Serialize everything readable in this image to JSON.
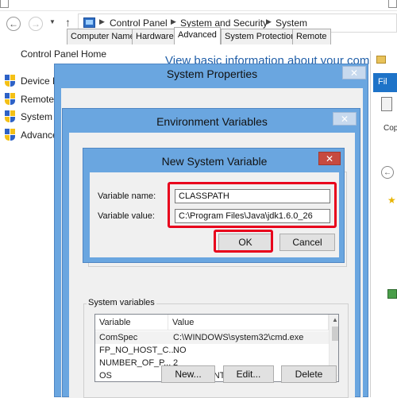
{
  "explorer": {
    "breadcrumbs": [
      "Control Panel",
      "System and Security",
      "System"
    ],
    "left_pane": {
      "home_link": "Control Panel Home",
      "links": [
        "Device M",
        "Remote",
        "System p",
        "Advance"
      ]
    },
    "heading": "View basic information about your com",
    "right_pane": {
      "ribbon_tab": "Fil",
      "copy_label": "Cop"
    }
  },
  "system_properties": {
    "title": "System Properties",
    "tabs": [
      "Computer Name",
      "Hardware",
      "Advanced",
      "System Protection",
      "Remote"
    ],
    "active_tab": "Advanced"
  },
  "environment_variables": {
    "title": "Environment Variables",
    "system_variables_label": "System variables",
    "columns": [
      "Variable",
      "Value"
    ],
    "rows": [
      {
        "variable": "ComSpec",
        "value": "C:\\WINDOWS\\system32\\cmd.exe"
      },
      {
        "variable": "FP_NO_HOST_C...",
        "value": "NO"
      },
      {
        "variable": "NUMBER_OF_P...",
        "value": "2"
      },
      {
        "variable": "OS",
        "value": "Windows_NT"
      }
    ],
    "buttons": {
      "new": "New...",
      "edit": "Edit...",
      "delete": "Delete"
    }
  },
  "new_system_variable": {
    "title": "New System Variable",
    "name_label": "Variable name:",
    "name_value": "CLASSPATH",
    "value_label": "Variable value:",
    "value_value": "C:\\Program Files\\Java\\jdk1.6.0_26",
    "ok_label": "OK",
    "cancel_label": "Cancel"
  },
  "colors": {
    "highlight": "#e8001c",
    "window_frame": "#6aa6e0",
    "dialog_close": "#c74a3f",
    "link": "#1f5ea8"
  }
}
